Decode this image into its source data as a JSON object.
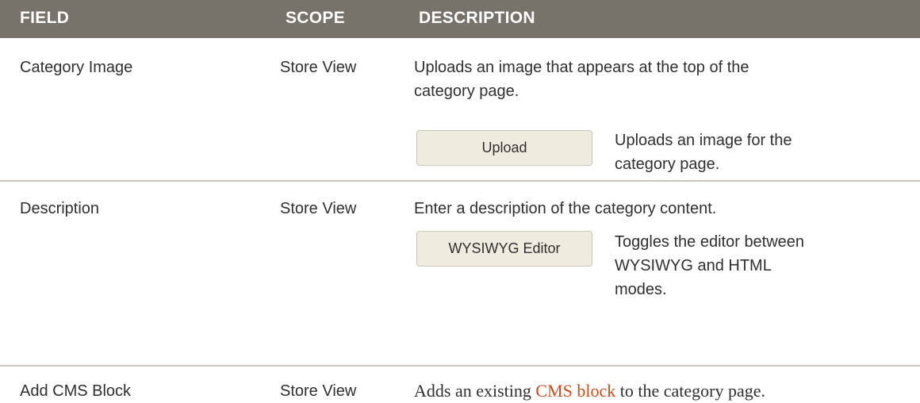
{
  "header": {
    "field": "FIELD",
    "scope": "SCOPE",
    "description": "DESCRIPTION"
  },
  "rows": [
    {
      "field": "Category Image",
      "scope": "Store View",
      "description": "Uploads an image that appears at the top of the category page.",
      "control": {
        "label": "Upload",
        "description": "Uploads an image for the category page."
      }
    },
    {
      "field": "Description",
      "scope": "Store View",
      "description": "Enter a description of the category content.",
      "control": {
        "label": "WYSIWYG Editor",
        "description": "Toggles the editor between WYSIWYG and HTML modes."
      }
    },
    {
      "field": "Add CMS Block",
      "scope": "Store View",
      "description_before": "Adds an existing",
      "description_link": "CMS block",
      "description_after": "to the category page."
    }
  ],
  "colors": {
    "header_bg": "#77736b",
    "button_bg": "#f0ebdf",
    "link": "#d04a1a"
  }
}
